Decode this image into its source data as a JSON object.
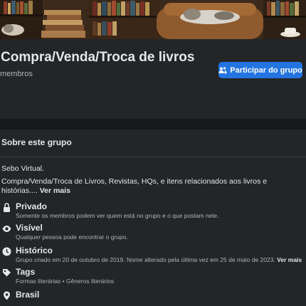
{
  "group": {
    "title": "Compra/Venda/Troca de livros",
    "members_label": "membros",
    "join_label": "Participar do grupo"
  },
  "about": {
    "heading": "Sobre este grupo",
    "desc_line1": "Sebo Virtual.",
    "desc_line2": "Compra/Venda/Troca de Livros, Revistas, HQs, e itens relacionados aos livros e histórias....",
    "see_more": "Ver mais",
    "items": [
      {
        "icon": "lock-icon",
        "title": "Privado",
        "subtitle": "Somente os membros podem ver quem está no grupo e o que postam nele."
      },
      {
        "icon": "eye-icon",
        "title": "Visível",
        "subtitle": "Qualquer pessoa pode encontrar o grupo."
      },
      {
        "icon": "clock-icon",
        "title": "Histórico",
        "subtitle": "Grupo criado em 20 de outubro de 2019. Nome alterado pela última vez em 25 de maio de 2023.",
        "see_more": "Ver mais"
      },
      {
        "icon": "tag-icon",
        "title": "Tags",
        "subtitle": "Formas literárias • Gêneros literários"
      },
      {
        "icon": "location-pin-icon",
        "title": "Brasil",
        "subtitle": ""
      }
    ]
  },
  "colors": {
    "background": "#18191a",
    "card": "#242526",
    "accent": "#2374e1",
    "text_primary": "#e4e6eb",
    "text_secondary": "#b0b3b8"
  }
}
